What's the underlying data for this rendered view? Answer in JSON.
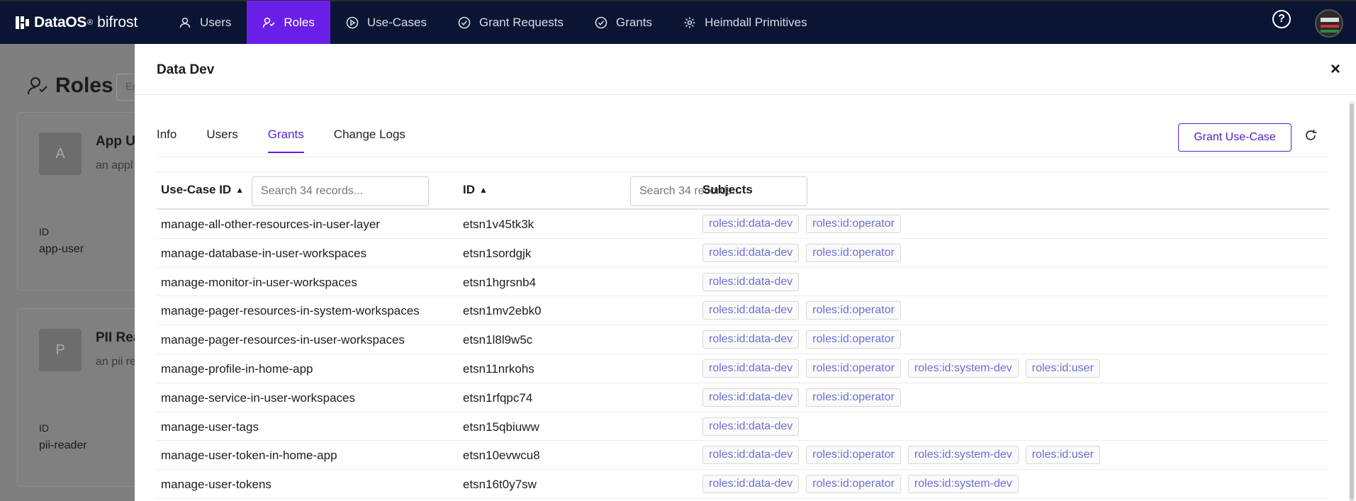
{
  "nav": {
    "brand_name": "DataOS",
    "brand_reg": "®",
    "brand_sub": "bifrost",
    "items": [
      {
        "label": "Users",
        "icon": "user-icon"
      },
      {
        "label": "Roles",
        "icon": "roles-icon",
        "active": true
      },
      {
        "label": "Use-Cases",
        "icon": "play-circle-icon"
      },
      {
        "label": "Grant Requests",
        "icon": "check-circle-icon"
      },
      {
        "label": "Grants",
        "icon": "check-circle-icon"
      },
      {
        "label": "Heimdall Primitives",
        "icon": "gear-icon"
      }
    ],
    "help_label": "?",
    "active_color": "#6a1fe8"
  },
  "background": {
    "title": "Roles",
    "search_placeholder": "En",
    "cards": [
      {
        "avatar": "A",
        "title": "App Us",
        "desc": "an appl",
        "id_label": "ID",
        "id_value": "app-user"
      },
      {
        "avatar": "P",
        "title": "PII Rea",
        "desc": "an pii re",
        "id_label": "ID",
        "id_value": "pii-reader"
      }
    ]
  },
  "drawer": {
    "title": "Data Dev",
    "close_label": "×",
    "tabs": [
      {
        "label": "Info"
      },
      {
        "label": "Users"
      },
      {
        "label": "Grants",
        "active": true
      },
      {
        "label": "Change Logs"
      }
    ],
    "grant_button": "Grant Use-Case"
  },
  "table": {
    "columns": {
      "usecase": "Use-Case ID",
      "id": "ID",
      "subjects": "Subjects"
    },
    "sort_glyph": "▲",
    "search_placeholder": "Search 34 records...",
    "rows": [
      {
        "usecase": "manage-all-other-resources-in-user-layer",
        "id": "etsn1v45tk3k",
        "subjects": [
          "roles:id:data-dev",
          "roles:id:operator"
        ]
      },
      {
        "usecase": "manage-database-in-user-workspaces",
        "id": "etsn1sordgjk",
        "subjects": [
          "roles:id:data-dev",
          "roles:id:operator"
        ]
      },
      {
        "usecase": "manage-monitor-in-user-workspaces",
        "id": "etsn1hgrsnb4",
        "subjects": [
          "roles:id:data-dev"
        ]
      },
      {
        "usecase": "manage-pager-resources-in-system-workspaces",
        "id": "etsn1mv2ebk0",
        "subjects": [
          "roles:id:data-dev",
          "roles:id:operator"
        ]
      },
      {
        "usecase": "manage-pager-resources-in-user-workspaces",
        "id": "etsn1l8l9w5c",
        "subjects": [
          "roles:id:data-dev",
          "roles:id:operator"
        ]
      },
      {
        "usecase": "manage-profile-in-home-app",
        "id": "etsn11nrkohs",
        "subjects": [
          "roles:id:data-dev",
          "roles:id:operator",
          "roles:id:system-dev",
          "roles:id:user"
        ]
      },
      {
        "usecase": "manage-service-in-user-workspaces",
        "id": "etsn1rfqpc74",
        "subjects": [
          "roles:id:data-dev",
          "roles:id:operator"
        ]
      },
      {
        "usecase": "manage-user-tags",
        "id": "etsn15qbiuww",
        "subjects": [
          "roles:id:data-dev"
        ]
      },
      {
        "usecase": "manage-user-token-in-home-app",
        "id": "etsn10evwcu8",
        "subjects": [
          "roles:id:data-dev",
          "roles:id:operator",
          "roles:id:system-dev",
          "roles:id:user"
        ]
      },
      {
        "usecase": "manage-user-tokens",
        "id": "etsn16t0y7sw",
        "subjects": [
          "roles:id:data-dev",
          "roles:id:operator",
          "roles:id:system-dev"
        ]
      }
    ]
  }
}
